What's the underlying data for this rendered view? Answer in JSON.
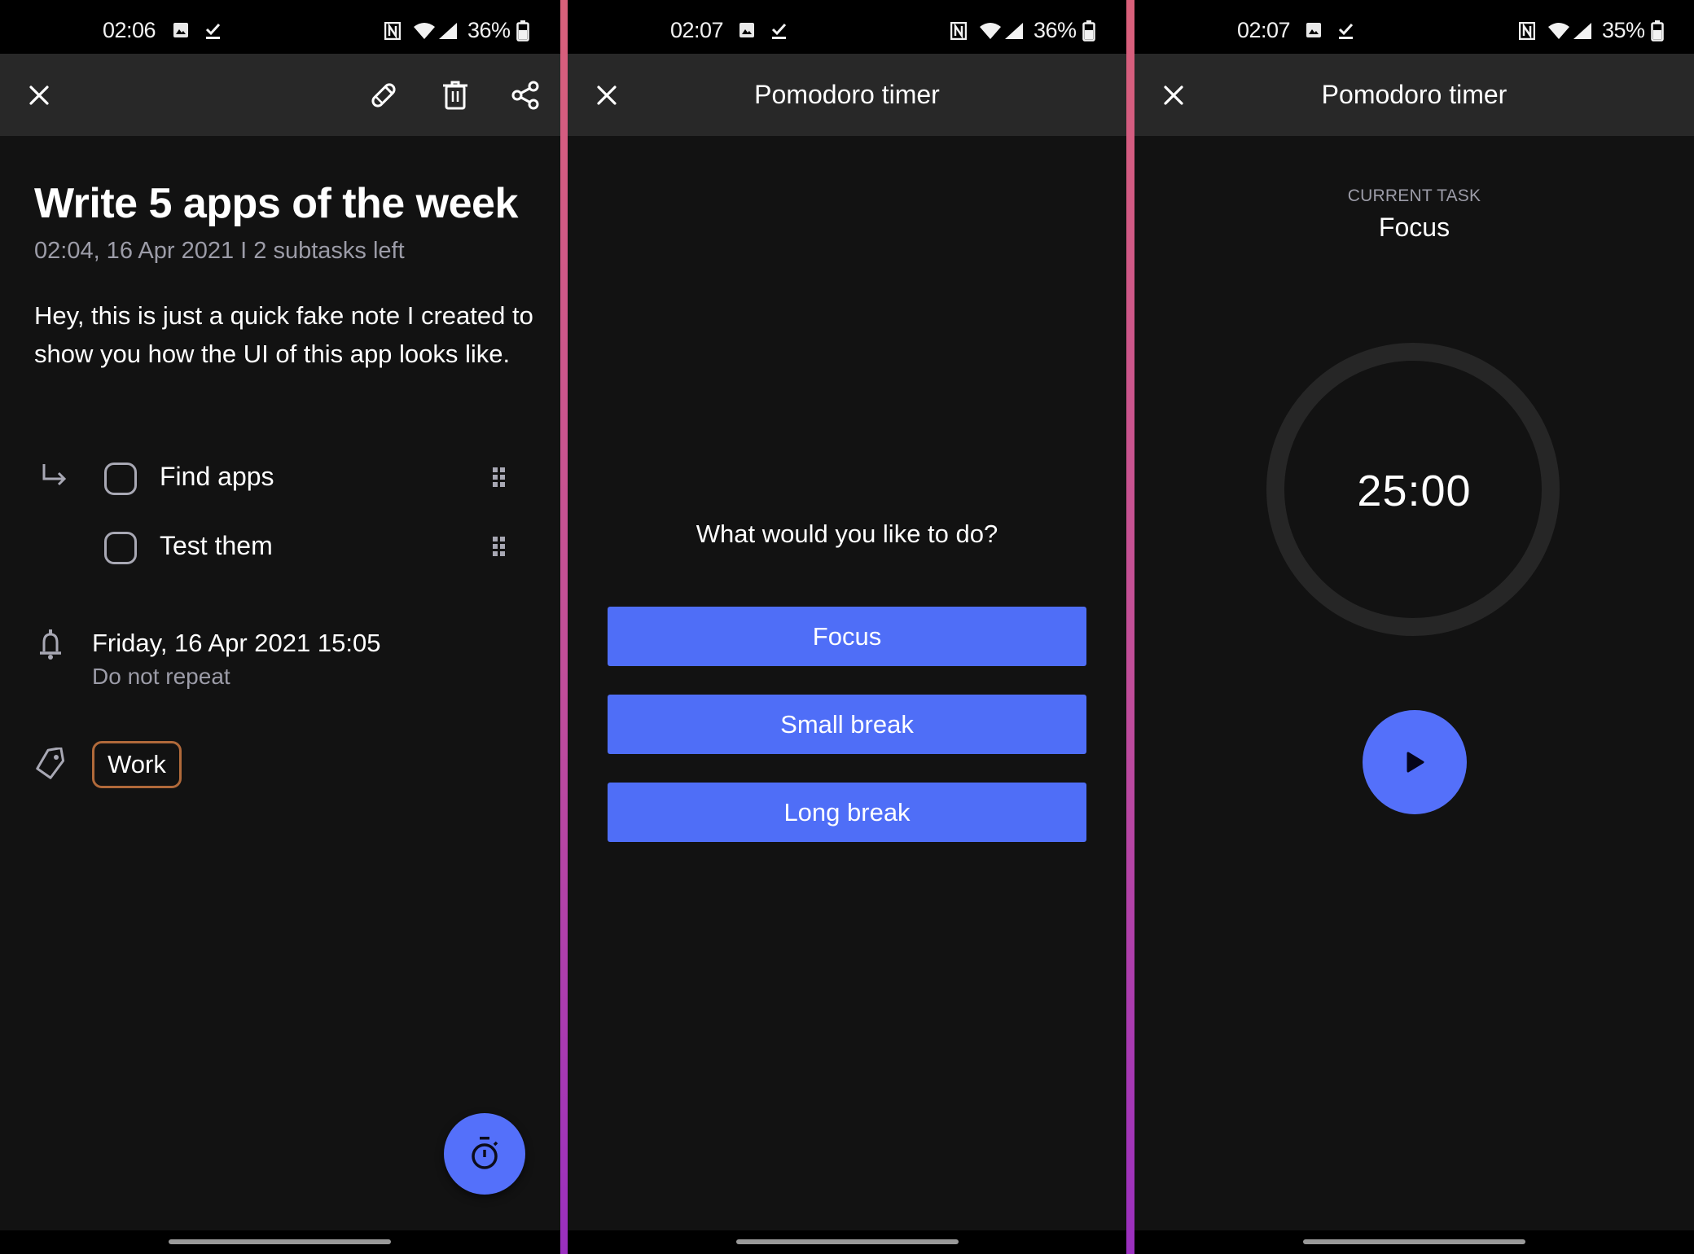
{
  "colors": {
    "accent": "#5470fa",
    "button": "#4f6ef7",
    "tag_border": "#b0693a",
    "background": "#121212",
    "toolbar": "#282828",
    "muted_text": "#9c9ca8",
    "divider_top": "#d9607a",
    "divider_bottom": "#9a2fbf"
  },
  "screens": [
    {
      "status": {
        "time": "02:06",
        "battery": "36%",
        "icons": [
          "image-icon",
          "download-done-icon",
          "nfc-icon",
          "wifi-icon",
          "signal-icon",
          "battery-icon"
        ]
      },
      "toolbar": {
        "close_icon": "close-icon",
        "actions": [
          "edit-icon",
          "delete-icon",
          "share-icon"
        ]
      },
      "note": {
        "title": "Write 5 apps of the week",
        "meta": "02:04, 16 Apr 2021  I  2 subtasks left",
        "body": "Hey, this is just a quick fake note I created to show you how the UI of this app looks like.",
        "subtasks": [
          {
            "label": "Find apps",
            "checked": false
          },
          {
            "label": "Test them",
            "checked": false
          }
        ],
        "reminder": {
          "date": "Friday, 16 Apr 2021 15:05",
          "repeat": "Do not repeat"
        },
        "tags": [
          "Work"
        ],
        "fab_icon": "stopwatch-icon"
      }
    },
    {
      "status": {
        "time": "02:07",
        "battery": "36%"
      },
      "toolbar": {
        "title": "Pomodoro timer"
      },
      "question": "What would you like to do?",
      "options": [
        "Focus",
        "Small break",
        "Long break"
      ]
    },
    {
      "status": {
        "time": "02:07",
        "battery": "35%"
      },
      "toolbar": {
        "title": "Pomodoro timer"
      },
      "current_task_label": "CURRENT TASK",
      "current_task": "Focus",
      "timer": "25:00",
      "progress": 0,
      "play_icon": "play-icon"
    }
  ]
}
